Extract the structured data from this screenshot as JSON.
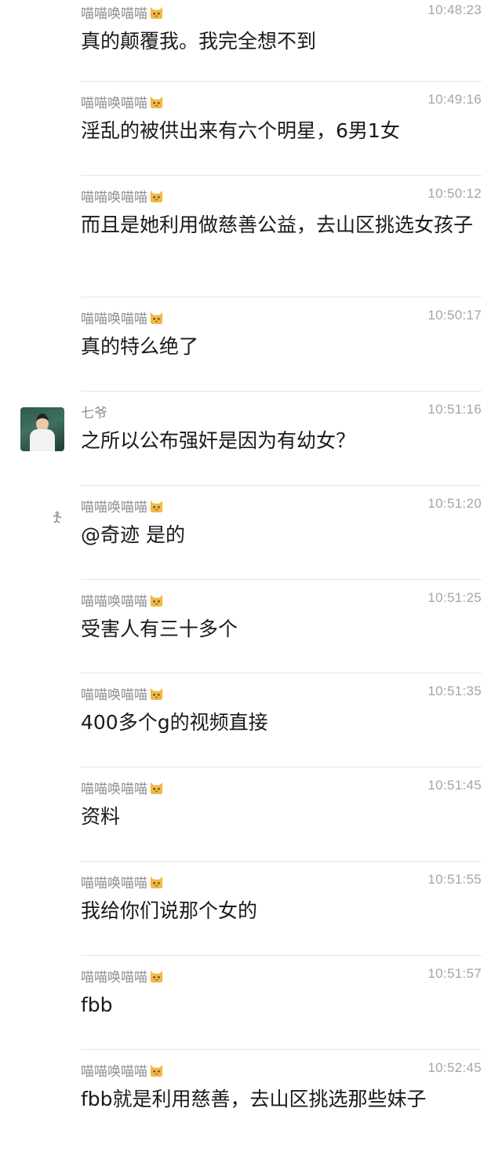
{
  "messages": [
    {
      "sender": "喵喵唤喵喵",
      "time": "10:48:23",
      "text": "真的颠覆我。我完全想不到"
    },
    {
      "sender": "喵喵唤喵喵",
      "time": "10:49:16",
      "text": "淫乱的被供出来有六个明星，6男1女"
    },
    {
      "sender": "喵喵唤喵喵",
      "time": "10:50:12",
      "text": "而且是她利用做慈善公益，去山区挑选女孩子"
    },
    {
      "sender": "喵喵唤喵喵",
      "time": "10:50:17",
      "text": "真的特么绝了"
    },
    {
      "sender": "七爷",
      "time": "10:51:16",
      "text": "之所以公布强奸是因为有幼女？"
    },
    {
      "sender": "喵喵唤喵喵",
      "time": "10:51:20",
      "text": "@奇迹 是的"
    },
    {
      "sender": "喵喵唤喵喵",
      "time": "10:51:25",
      "text": "受害人有三十多个"
    },
    {
      "sender": "喵喵唤喵喵",
      "time": "10:51:35",
      "text": "400多个g的视频直接"
    },
    {
      "sender": "喵喵唤喵喵",
      "time": "10:51:45",
      "text": "资料"
    },
    {
      "sender": "喵喵唤喵喵",
      "time": "10:51:55",
      "text": "我给你们说那个女的"
    },
    {
      "sender": "喵喵唤喵喵",
      "time": "10:51:57",
      "text": "fbb"
    },
    {
      "sender": "喵喵唤喵喵",
      "time": "10:52:45",
      "text": "fbb就是利用慈善，去山区挑选那些妹子"
    }
  ],
  "icons": {
    "sender_suffix": "cat-emoji-icon",
    "avatar_qiye": "user-photo-avatar",
    "avatar_small": "small-figure-avatar-icon"
  },
  "colors": {
    "background": "#ffffff",
    "sender_name": "#8f8f8f",
    "timestamp": "#a5a5a5",
    "message_text": "#1a1a1a",
    "divider": "#e6e6e6",
    "cat_emoji": "#f2b845"
  }
}
